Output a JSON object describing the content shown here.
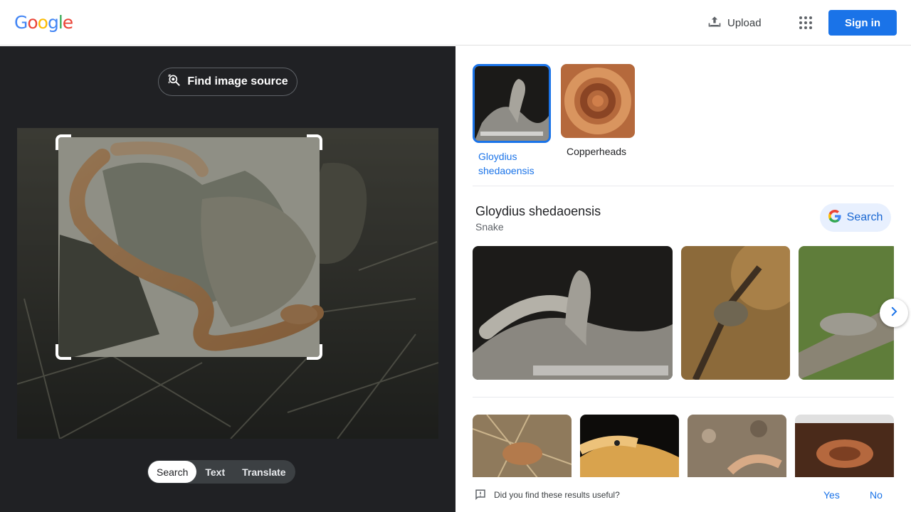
{
  "header": {
    "logo_letters": [
      {
        "ch": "G",
        "color": "#4285f4"
      },
      {
        "ch": "o",
        "color": "#ea4335"
      },
      {
        "ch": "o",
        "color": "#fbbc05"
      },
      {
        "ch": "g",
        "color": "#4285f4"
      },
      {
        "ch": "l",
        "color": "#34a853"
      },
      {
        "ch": "e",
        "color": "#ea4335"
      }
    ],
    "upload_label": "Upload",
    "upload_icon": "upload-icon",
    "apps_icon": "apps-grid-icon",
    "signin_label": "Sign in"
  },
  "left": {
    "find_source_label": "Find image source",
    "find_source_icon": "lens-search-icon",
    "modes": [
      "Search",
      "Text",
      "Translate"
    ],
    "active_mode": "Search"
  },
  "right": {
    "chips": [
      {
        "label": "Gloydius shedaoensis",
        "selected": true
      },
      {
        "label": "Copperheads",
        "selected": false
      }
    ],
    "entity": {
      "title": "Gloydius shedaoensis",
      "subtitle": "Snake",
      "search_label": "Search"
    },
    "feedback": {
      "question": "Did you find these results useful?",
      "yes": "Yes",
      "no": "No"
    }
  },
  "colors": {
    "accent": "#1a73e8",
    "dark_panel": "#202124",
    "chip_bg": "#e8f0fe"
  }
}
